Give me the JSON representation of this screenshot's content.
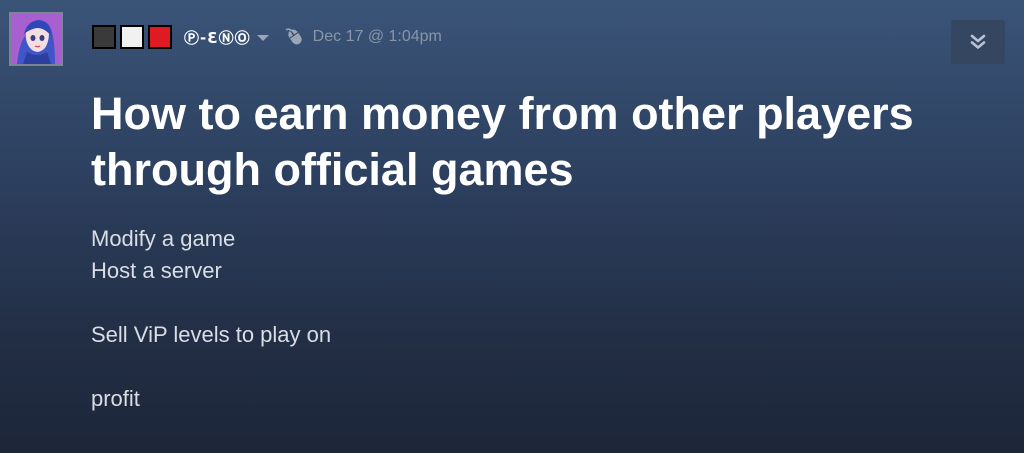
{
  "post": {
    "author": {
      "name": "Ⓟ-ƐⓃⓄ",
      "avatar_icon": "anime-avatar-icon",
      "flags": [
        {
          "name": "dark-square",
          "color": "#3a3a3a"
        },
        {
          "name": "white-square",
          "color": "#f1f1f1"
        },
        {
          "name": "red-square",
          "color": "#e01a22"
        }
      ]
    },
    "device_icon": "mouse-icon",
    "timestamp": "Dec 17 @ 1:04pm",
    "title": "How to earn money from other players through official games",
    "body_lines": [
      "Modify a game",
      "Host a server",
      "",
      "Sell ViP levels to play on",
      "",
      "profit"
    ],
    "collapse_icon": "double-chevron-down-icon"
  },
  "colors": {
    "background_top": "#3a5478",
    "background_bottom": "#1d2639",
    "title": "#ffffff",
    "body": "#d9dde4",
    "timestamp": "#8996aa",
    "button_bg": "#344660"
  }
}
